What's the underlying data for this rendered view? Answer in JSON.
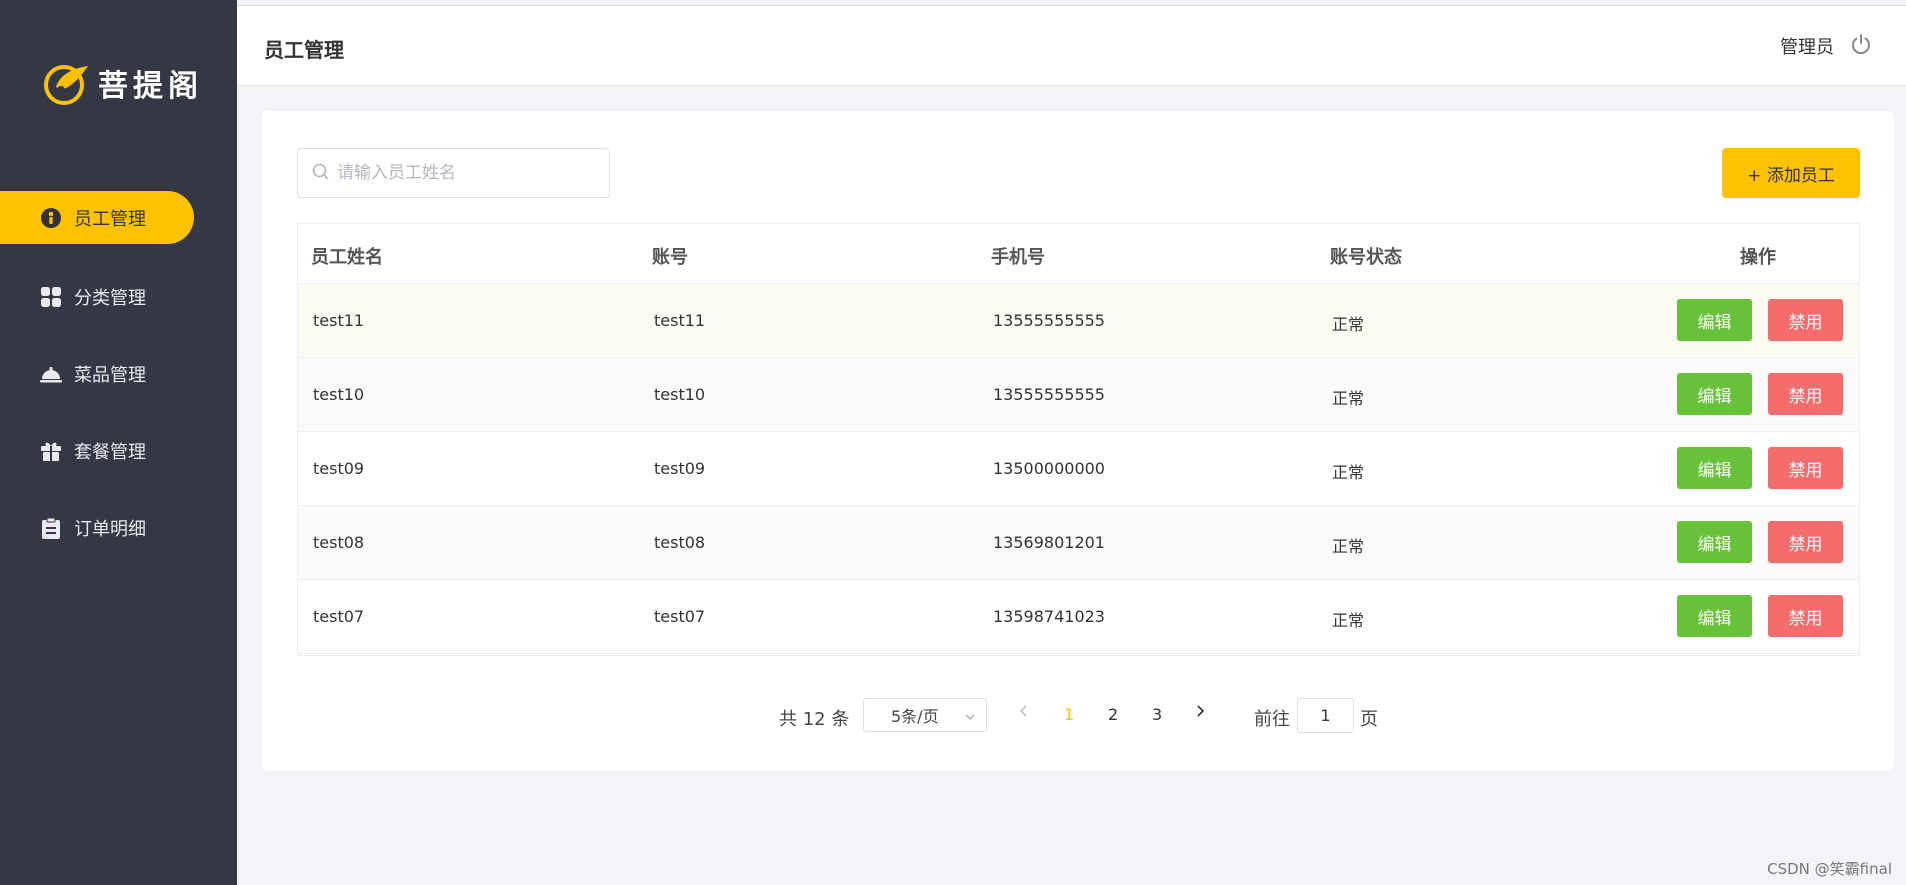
{
  "brand": {
    "name": "菩提阁",
    "logo_icon": "leaf-logo-icon",
    "accent": "#ffc200"
  },
  "sidebar": {
    "items": [
      {
        "label": "员工管理",
        "icon": "employee-icon",
        "active": true
      },
      {
        "label": "分类管理",
        "icon": "category-grid-icon",
        "active": false
      },
      {
        "label": "菜品管理",
        "icon": "dish-cloche-icon",
        "active": false
      },
      {
        "label": "套餐管理",
        "icon": "gift-package-icon",
        "active": false
      },
      {
        "label": "订单明细",
        "icon": "clipboard-icon",
        "active": false
      }
    ]
  },
  "header": {
    "title": "员工管理",
    "user": "管理员",
    "logout_icon": "power-icon"
  },
  "toolbar": {
    "search_placeholder": "请输入员工姓名",
    "search_value": "",
    "add_label": "+ 添加员工"
  },
  "table": {
    "columns": [
      "员工姓名",
      "账号",
      "手机号",
      "账号状态",
      "操作"
    ],
    "rows": [
      {
        "name": "test11",
        "account": "test11",
        "phone": "13555555555",
        "status": "正常"
      },
      {
        "name": "test10",
        "account": "test10",
        "phone": "13555555555",
        "status": "正常"
      },
      {
        "name": "test09",
        "account": "test09",
        "phone": "13500000000",
        "status": "正常"
      },
      {
        "name": "test08",
        "account": "test08",
        "phone": "13569801201",
        "status": "正常"
      },
      {
        "name": "test07",
        "account": "test07",
        "phone": "13598741023",
        "status": "正常"
      }
    ],
    "edit_label": "编辑",
    "disable_label": "禁用"
  },
  "pagination": {
    "total_text": "共 12 条",
    "page_size": "5条/页",
    "pages": [
      "1",
      "2",
      "3"
    ],
    "current_page": "1",
    "jump_prefix": "前往",
    "jump_value": "1",
    "jump_suffix": "页"
  },
  "watermark": "CSDN @笑霸final"
}
